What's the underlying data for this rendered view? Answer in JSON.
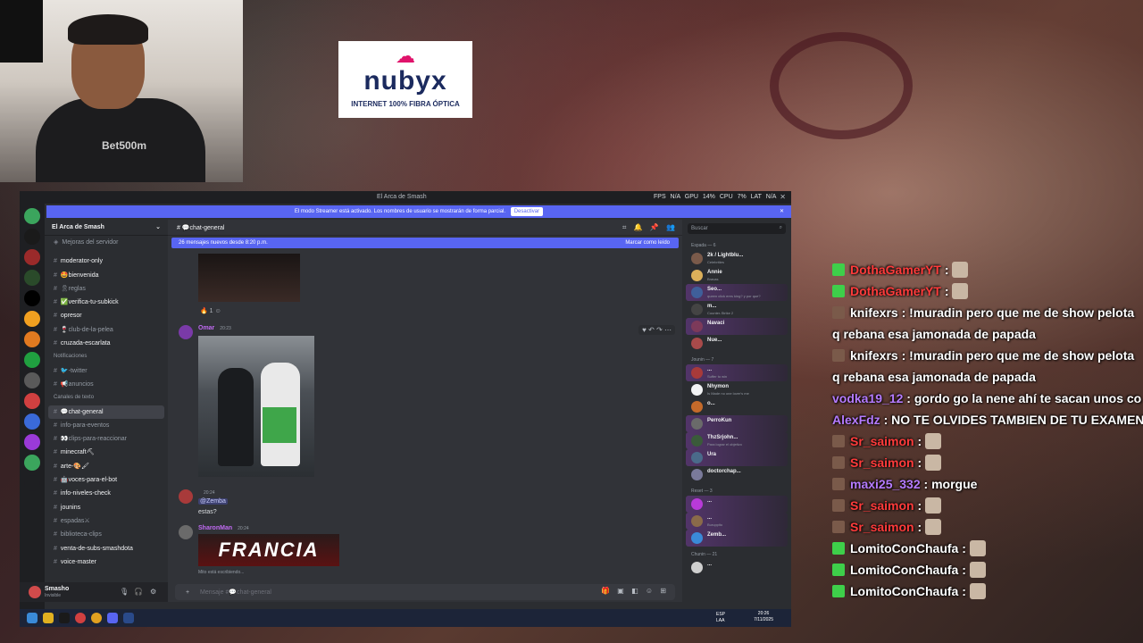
{
  "stream": {
    "webcam_shirt_text": "Bet500m",
    "sponsor": {
      "brand": "nubyx",
      "tagline": "INTERNET 100% FIBRA ÓPTICA"
    },
    "chat": [
      {
        "user": "DothaGamerYT",
        "text": ":",
        "color": "#ff3b3b",
        "badge": "#3ecf4a",
        "emote": true
      },
      {
        "user": "DothaGamerYT",
        "text": ":",
        "color": "#ff3b3b",
        "badge": "#3ecf4a",
        "emote": true
      },
      {
        "user": "knifexrs",
        "text": ": !muradin pero que me de show pelota q rebana esa jamonada de papada",
        "color": "#ffffff",
        "badge": "#7a5a4a",
        "emote": false
      },
      {
        "user": "knifexrs",
        "text": ": !muradin pero que me de show pelota q rebana esa jamonada de papada",
        "color": "#ffffff",
        "badge": "#7a5a4a",
        "emote": false
      },
      {
        "user": "vodka19_12",
        "text": ": gordo go la nene ahí te sacan unos co",
        "color": "#b57bff",
        "badge": "",
        "emote": false
      },
      {
        "user": "AlexFdz",
        "text": ": NO TE OLVIDES TAMBIEN DE TU EXAMEN",
        "color": "#b57bff",
        "badge": "",
        "emote": false
      },
      {
        "user": "Sr_saimon",
        "text": ":",
        "color": "#ff3b3b",
        "badge": "#7a5a4a",
        "emote": true
      },
      {
        "user": "Sr_saimon",
        "text": ":",
        "color": "#ff3b3b",
        "badge": "#7a5a4a",
        "emote": true
      },
      {
        "user": "maxi25_332",
        "text": ": morgue",
        "color": "#b57bff",
        "badge": "#7a5a4a",
        "emote": false
      },
      {
        "user": "Sr_saimon",
        "text": ":",
        "color": "#ff3b3b",
        "badge": "#7a5a4a",
        "emote": true
      },
      {
        "user": "Sr_saimon",
        "text": ":",
        "color": "#ff3b3b",
        "badge": "#7a5a4a",
        "emote": true
      },
      {
        "user": "LomitoConChaufa",
        "text": ":",
        "color": "#ffffff",
        "badge": "#3ecf4a",
        "emote": true
      },
      {
        "user": "LomitoConChaufa",
        "text": ":",
        "color": "#ffffff",
        "badge": "#3ecf4a",
        "emote": true
      },
      {
        "user": "LomitoConChaufa",
        "text": ":",
        "color": "#ffffff",
        "badge": "#3ecf4a",
        "emote": true
      }
    ]
  },
  "discord": {
    "window_title": "El Arca de Smash",
    "stats": "FPS N/A   GPU 14%   CPU 7%   LAT N/A",
    "banner": {
      "text": "El modo Streamer está activado. Los nombres de usuario se mostrarán de forma parcial.",
      "button": "Desactivar"
    },
    "server": {
      "name": "El Arca de Smash",
      "boost": "Mejoras del servidor"
    },
    "channels": [
      {
        "label": "moderator-only",
        "kind": "channel",
        "bright": true
      },
      {
        "label": "🤩bienvenida",
        "kind": "channel",
        "bright": true
      },
      {
        "label": "🎗reglas",
        "kind": "channel",
        "bright": false
      },
      {
        "label": "✅verifica-tu-subkick",
        "kind": "channel",
        "bright": true
      },
      {
        "label": "opresor",
        "kind": "channel",
        "bright": true
      },
      {
        "label": "🍷club-de-la-pelea",
        "kind": "channel",
        "bright": false
      },
      {
        "label": "cruzada-escarlata",
        "kind": "channel",
        "bright": true
      },
      {
        "label": "Notificaciones",
        "kind": "category",
        "bright": false
      },
      {
        "label": "🐦-twitter",
        "kind": "channel",
        "bright": false
      },
      {
        "label": "📢anuncios",
        "kind": "channel",
        "bright": false
      },
      {
        "label": "Canales de texto",
        "kind": "category",
        "bright": false
      },
      {
        "label": "💬chat-general",
        "kind": "active",
        "bright": true
      },
      {
        "label": "info-para-eventos",
        "kind": "channel",
        "bright": false
      },
      {
        "label": "👀clips-para-reaccionar",
        "kind": "channel",
        "bright": false
      },
      {
        "label": "minecraft⛏",
        "kind": "channel",
        "bright": true
      },
      {
        "label": "arte-🎨🖌",
        "kind": "channel",
        "bright": true
      },
      {
        "label": "🤖voces-para-el-bot",
        "kind": "channel",
        "bright": true
      },
      {
        "label": "info-niveles-check",
        "kind": "channel",
        "bright": true
      },
      {
        "label": "jounins",
        "kind": "channel",
        "bright": true
      },
      {
        "label": "espadas⚔",
        "kind": "channel",
        "bright": false
      },
      {
        "label": "biblioteca-clips",
        "kind": "channel",
        "bright": false
      },
      {
        "label": "venta-de-subs-smashdota",
        "kind": "channel",
        "bright": true
      },
      {
        "label": "voice-master",
        "kind": "channel",
        "bright": true
      }
    ],
    "user": {
      "name": "Smasho",
      "status": "Invisible"
    },
    "chat": {
      "channel": "💬chat-general",
      "new_messages": "26 mensajes nuevos desde 8:20 p.m.",
      "mark_read": "Marcar como leído",
      "reaction_count": "1",
      "msg1": {
        "author": "Omar",
        "time": "20:23"
      },
      "msg2": {
        "author": "",
        "time": "20:24",
        "mention": "@Zemba",
        "text": "estas?"
      },
      "msg3": {
        "author": "SharonMan",
        "time": "20:24",
        "image_text": "FRANCIA"
      },
      "typing": "Mito está escribiendo...",
      "placeholder": "Mensaje #💬chat-general"
    },
    "members": {
      "search": "Buscar",
      "sections": [
        {
          "title": "Espada — 6",
          "people": [
            {
              "name": "2k / Lightblu...",
              "sub": "Celebrities",
              "color": "#f2f3f5",
              "avatar": "#7a5a4a",
              "hl": false
            },
            {
              "name": "Annie",
              "sub": "Bravas",
              "color": "#f2f3f5",
              "avatar": "#dcb05a",
              "hl": false
            },
            {
              "name": "Seo...",
              "sub": "queen click eres king? y por que?",
              "color": "#f2f3f5",
              "avatar": "#3f5f9a",
              "hl": true
            },
            {
              "name": "m...",
              "sub": "Counter-Strike 2",
              "color": "#f2f3f5",
              "avatar": "#444",
              "hl": false
            },
            {
              "name": "Navaci",
              "sub": "",
              "color": "#f2f3f5",
              "avatar": "#7d3a5a",
              "hl": true
            },
            {
              "name": "Nue...",
              "sub": "",
              "color": "#f2f3f5",
              "avatar": "#a84a4a",
              "hl": false
            }
          ]
        },
        {
          "title": "Jounin — 7",
          "people": [
            {
              "name": "...",
              "sub": "Suffer to win",
              "color": "#f2f3f5",
              "avatar": "#a83a3a",
              "hl": true
            },
            {
              "name": "Nhymon",
              "sub": "Is Made no one lover's me",
              "color": "#f2f3f5",
              "avatar": "#f2f3f5",
              "hl": false
            },
            {
              "name": "o...",
              "sub": "",
              "color": "#f2f3f5",
              "avatar": "#c46a2a",
              "hl": false
            },
            {
              "name": "PerroKun",
              "sub": "",
              "color": "#f2f3f5",
              "avatar": "#6a6a6a",
              "hl": true
            },
            {
              "name": "ThzSrjohn...",
              "sub": "Para lograr el objetivo",
              "color": "#f2f3f5",
              "avatar": "#3a5a3a",
              "hl": true
            },
            {
              "name": "Ura",
              "sub": "",
              "color": "#f2f3f5",
              "avatar": "#4a6a8a",
              "hl": true
            },
            {
              "name": "doctorchap...",
              "sub": "",
              "color": "#f2f3f5",
              "avatar": "#7a7a9a",
              "hl": false
            }
          ]
        },
        {
          "title": "Reset — 3",
          "people": [
            {
              "name": "...",
              "sub": "",
              "color": "#f2f3f5",
              "avatar": "#b83ad8",
              "hl": true
            },
            {
              "name": "...",
              "sub": "Buruppito",
              "color": "#f2f3f5",
              "avatar": "#8a6a4a",
              "hl": true
            },
            {
              "name": "Zemb...",
              "sub": "",
              "color": "#f2f3f5",
              "avatar": "#3a8ad8",
              "hl": true
            }
          ]
        },
        {
          "title": "Chunin — 21",
          "people": [
            {
              "name": "...",
              "sub": "",
              "color": "#f2f3f5",
              "avatar": "#cfcfcf",
              "hl": false
            }
          ]
        }
      ]
    },
    "taskbar": {
      "lang": "ESP",
      "kb": "LAA",
      "time": "20:26",
      "date": "7/11/2025"
    }
  },
  "guild_icons": [
    "#3ba55d",
    "#1a1a1a",
    "#9a2a2a",
    "#2a4a2a",
    "#000000",
    "#f0a020",
    "#e07a20",
    "#20a040",
    "#5a5a5a",
    "#d04040",
    "#3a6ad8",
    "#9a3ad8",
    "#3ba55d",
    "#1e1f22"
  ]
}
